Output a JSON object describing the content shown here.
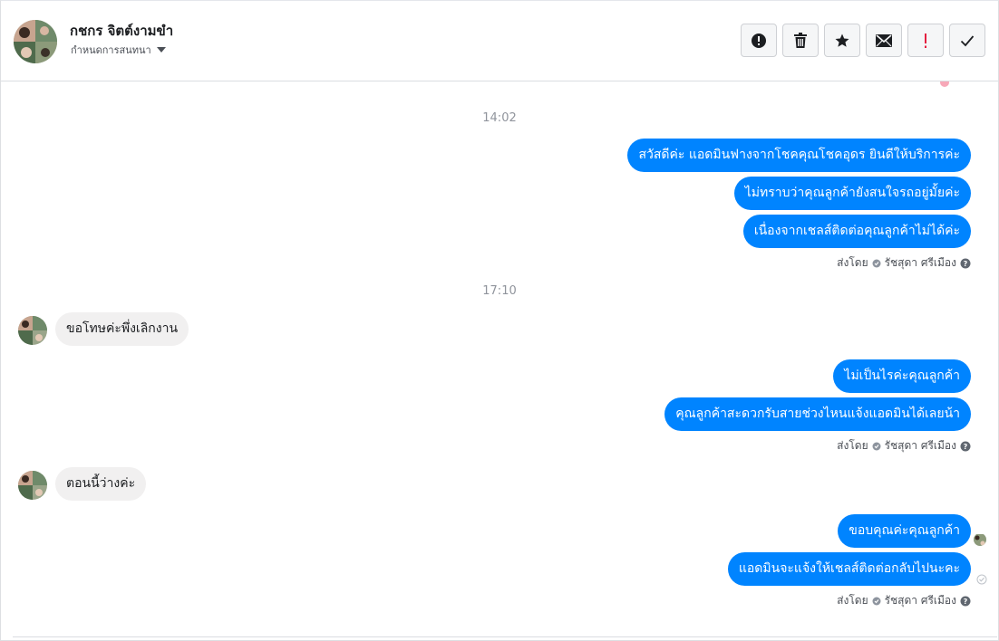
{
  "header": {
    "contact_name": "กชกร จิตต์งามขำ",
    "assign_label": "กำหนดการสนทนา",
    "actions": [
      {
        "name": "report-spam-button",
        "icon": "alert-circle-icon"
      },
      {
        "name": "delete-button",
        "icon": "trash-icon"
      },
      {
        "name": "star-button",
        "icon": "star-icon"
      },
      {
        "name": "mark-unread-button",
        "icon": "envelope-icon"
      },
      {
        "name": "follow-up-button",
        "icon": "exclamation-icon"
      },
      {
        "name": "mark-done-button",
        "icon": "checkmark-icon"
      }
    ]
  },
  "chat": {
    "groups": [
      {
        "time": "14:02",
        "outgoing": [
          "สวัสดีค่ะ แอดมินฟางจากโชคคุณโชคอุดร ยินดีให้บริการค่ะ",
          "ไม่ทราบว่าคุณลูกค้ายังสนใจรถอยู่มั้ยค่ะ",
          "เนื่องจากเชลส์ติดต่อคุณลูกค้าไม่ได้ค่ะ"
        ],
        "sent_by": {
          "prefix": "ส่งโดย",
          "name": "รัชสุดา ศรีเมือง"
        }
      },
      {
        "time": "17:10",
        "incoming": [
          "ขอโทษค่ะพึ่งเลิกงาน"
        ],
        "outgoing": [
          "ไม่เป็นไรค่ะคุณลูกค้า",
          "คุณลูกค้าสะดวกรับสายช่วงไหนแจ้งแอดมินได้เลยน้า"
        ],
        "sent_by": {
          "prefix": "ส่งโดย",
          "name": "รัชสุดา ศรีเมือง"
        }
      },
      {
        "incoming": [
          "ตอนนี้ว่างค่ะ"
        ],
        "outgoing": [
          "ขอบคุณค่ะคุณลูกค้า",
          "แอดมินจะแจ้งให้เชลส์ติดต่อกลับไปนะคะ"
        ],
        "sent_by": {
          "prefix": "ส่งโดย",
          "name": "รัชสุดา ศรีเมือง"
        }
      }
    ]
  },
  "colors": {
    "outgoing_bubble": "#0084ff",
    "incoming_bubble": "#f1f0f0",
    "follow_up_red": "#e41e3f"
  }
}
